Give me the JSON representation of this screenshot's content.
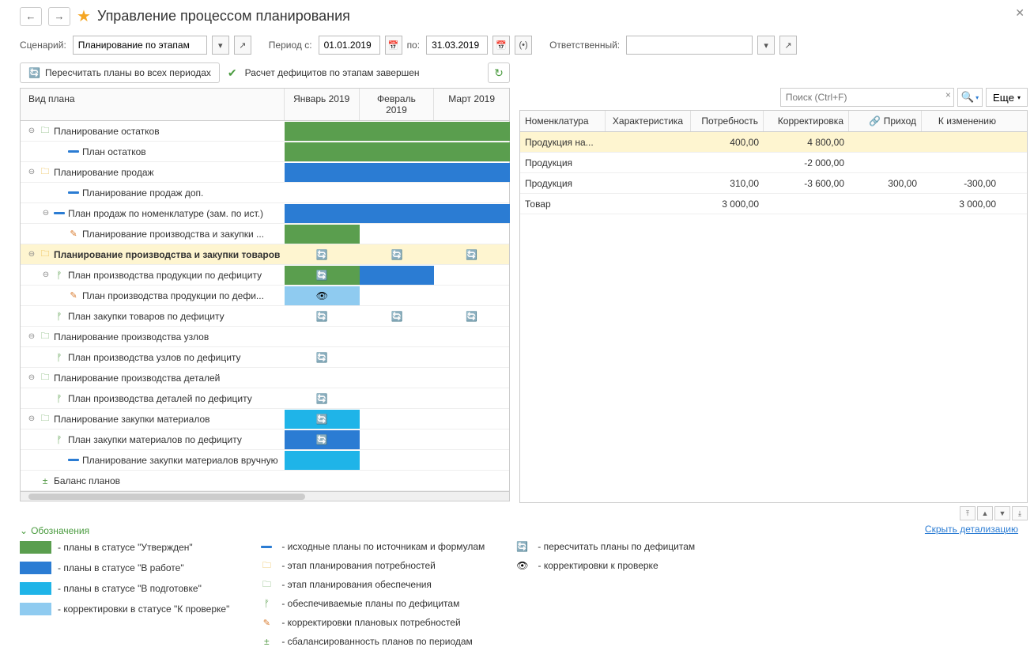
{
  "header": {
    "title": "Управление процессом планирования"
  },
  "toolbar": {
    "scenario_label": "Сценарий:",
    "scenario_value": "Планирование по этапам",
    "period_from_label": "Период с:",
    "period_from": "01.01.2019",
    "period_to_label": "по:",
    "period_to": "31.03.2019",
    "responsible_label": "Ответственный:",
    "responsible_value": ""
  },
  "actions": {
    "recalc_label": "Пересчитать планы во всех периодах",
    "status_text": "Расчет дефицитов по этапам завершен"
  },
  "grid": {
    "col_plan": "Вид плана",
    "col_m1": "Январь 2019",
    "col_m2": "Февраль 2019",
    "col_m3": "Март 2019",
    "rows": [
      {
        "label": "Планирование остатков",
        "indent": 0,
        "icon": "folder-g",
        "exp": true,
        "bar": {
          "type": "green",
          "span": 3
        }
      },
      {
        "label": "План остатков",
        "indent": 2,
        "icon": "dash-blue",
        "bar": {
          "type": "green",
          "span": 3
        }
      },
      {
        "label": "Планирование продаж",
        "indent": 0,
        "icon": "folder-y",
        "exp": true,
        "bar": {
          "type": "blue",
          "span": 3
        }
      },
      {
        "label": "Планирование продаж доп.",
        "indent": 2,
        "icon": "dash-blue"
      },
      {
        "label": "План продаж по номенклатуре (зам. по ист.)",
        "indent": 1,
        "icon": "dash-blue",
        "exp": true,
        "bar": {
          "type": "blue",
          "span": 3
        }
      },
      {
        "label": "Планирование производства и закупки ...",
        "indent": 2,
        "icon": "corr",
        "bar": {
          "type": "green",
          "span": 1
        }
      },
      {
        "label": "Планирование производства и закупки товаров",
        "indent": 0,
        "icon": "folder-y",
        "exp": true,
        "sel": true,
        "sync": [
          1,
          1,
          1
        ]
      },
      {
        "label": "План производства продукции по дефициту",
        "indent": 1,
        "icon": "tree",
        "exp": true,
        "bar": {
          "type": "green",
          "span": 1,
          "sync": true
        },
        "bar2": {
          "type": "blue",
          "span": 1
        }
      },
      {
        "label": "План производства продукции по дефи...",
        "indent": 2,
        "icon": "corr",
        "bar": {
          "type": "lblue",
          "span": 1,
          "eye": true
        }
      },
      {
        "label": "План закупки товаров по дефициту",
        "indent": 1,
        "icon": "tree",
        "sync": [
          1,
          1,
          1
        ]
      },
      {
        "label": "Планирование производства узлов",
        "indent": 0,
        "icon": "folder-g",
        "exp": true
      },
      {
        "label": "План производства узлов по дефициту",
        "indent": 1,
        "icon": "tree",
        "sync": [
          1,
          0,
          0
        ]
      },
      {
        "label": "Планирование производства деталей",
        "indent": 0,
        "icon": "folder-g",
        "exp": true
      },
      {
        "label": "План производства деталей по дефициту",
        "indent": 1,
        "icon": "tree",
        "sync": [
          1,
          0,
          0
        ]
      },
      {
        "label": "Планирование закупки материалов",
        "indent": 0,
        "icon": "folder-g",
        "exp": true,
        "bar": {
          "type": "cyan",
          "span": 1,
          "sync": true
        }
      },
      {
        "label": "План закупки материалов по дефициту",
        "indent": 1,
        "icon": "tree",
        "bar": {
          "type": "blue",
          "span": 1,
          "sync": true
        }
      },
      {
        "label": "Планирование закупки материалов вручную",
        "indent": 2,
        "icon": "dash-blue",
        "bar": {
          "type": "cyan",
          "span": 1
        }
      },
      {
        "label": "Баланс планов",
        "indent": 0,
        "icon": "bal"
      }
    ]
  },
  "right": {
    "search_placeholder": "Поиск (Ctrl+F)",
    "more_label": "Еще",
    "cols": {
      "c1": "Номенклатура",
      "c2": "Характеристика",
      "c3": "Потребность",
      "c4": "Корректировка",
      "c5": "Приход",
      "c6": "К изменению",
      "link_icon": "🔗"
    },
    "rows": [
      {
        "c1": "Продукция на...",
        "c3": "400,00",
        "c4": "4 800,00",
        "sel": true
      },
      {
        "c1": "Продукция",
        "c4": "-2 000,00"
      },
      {
        "c1": "Продукция",
        "c3": "310,00",
        "c4": "-3 600,00",
        "c5": "300,00",
        "c6": "-300,00"
      },
      {
        "c1": "Товар",
        "c3": "3 000,00",
        "c6": "3 000,00"
      }
    ]
  },
  "legend": {
    "toggle": "Обозначения",
    "hide_link": "Скрыть детализацию",
    "col1": [
      {
        "swatch": "sw-green",
        "text": "- планы в статусе \"Утвержден\""
      },
      {
        "swatch": "sw-blue",
        "text": "- планы в статусе \"В работе\""
      },
      {
        "swatch": "sw-cyan",
        "text": "- планы в статусе \"В подготовке\""
      },
      {
        "swatch": "sw-lblue",
        "text": "- корректировки в статусе \"К проверке\""
      }
    ],
    "col2": [
      {
        "icon": "dash-blue",
        "text": "- исходные планы по источникам и формулам"
      },
      {
        "icon": "folder-y",
        "text": "- этап планирования потребностей"
      },
      {
        "icon": "folder-g",
        "text": "- этап планирования обеспечения"
      },
      {
        "icon": "tree",
        "text": "- обеспечиваемые планы по дефицитам"
      },
      {
        "icon": "corr",
        "text": "- корректировки плановых потребностей"
      },
      {
        "icon": "bal",
        "text": "- сбалансированность планов по периодам"
      }
    ],
    "col3": [
      {
        "icon": "sync",
        "text": "- пересчитать планы по дефицитам"
      },
      {
        "icon": "eye",
        "text": "- корректировки к проверке"
      }
    ]
  }
}
